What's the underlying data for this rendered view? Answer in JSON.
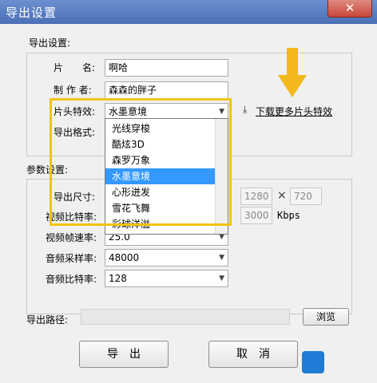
{
  "window": {
    "title": "导出设置",
    "close_label": "✕"
  },
  "export_settings": {
    "section_label": "导出设置:",
    "name_label": "片　　名:",
    "name_value": "啊哈",
    "author_label": "制 作 者:",
    "author_value": "森森的胖子",
    "effect_label": "片头特效:",
    "effect_value": "水墨意境",
    "download_link": "下载更多片头特效",
    "format_label": "导出格式:"
  },
  "effect_dropdown": {
    "options": [
      "光线穿梭",
      "酷炫3D",
      "森罗万象",
      "水墨意境",
      "心形迸发",
      "雪花飞舞",
      "彩球洋溢"
    ],
    "selected_index": 3
  },
  "param_settings": {
    "section_label": "参数设置:",
    "size_label": "导出尺寸:",
    "width_value": "1280",
    "times_sign": "×",
    "height_value": "720",
    "video_bitrate_label": "视频比特率:",
    "video_bitrate_value": "3000",
    "video_bitrate_unit": "Kbps",
    "framerate_label": "视频帧速率:",
    "framerate_value": "25.0",
    "samplerate_label": "音频采样率:",
    "samplerate_value": "48000",
    "audio_bitrate_label": "音频比特率:",
    "audio_bitrate_value": "128"
  },
  "export_path": {
    "label": "导出路径:",
    "browse_label": "浏览"
  },
  "buttons": {
    "export_label": "导　出",
    "cancel_label": "取　消"
  },
  "colors": {
    "titlebar": "#5a7fc4",
    "highlight_box": "#f1c40f",
    "selected": "#3399ff"
  }
}
